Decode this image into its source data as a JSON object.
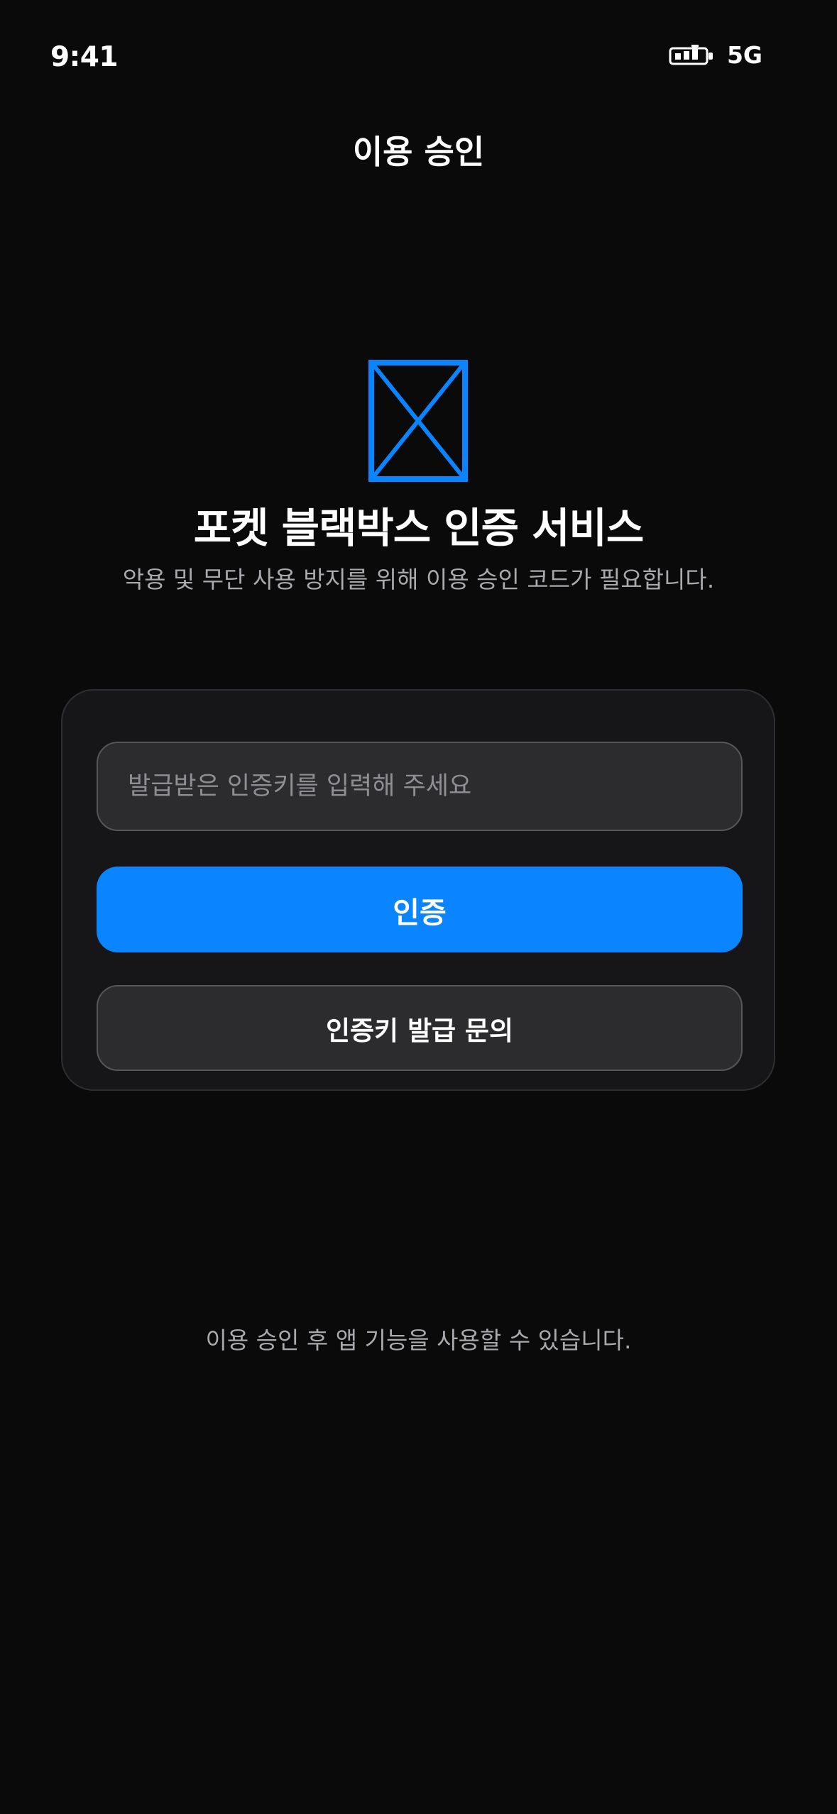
{
  "status_bar": {
    "time": "9:41",
    "network": "5G",
    "battery_icon": "battery-icon"
  },
  "nav": {
    "title": "이용 승인"
  },
  "hero": {
    "icon": "image-placeholder-icon",
    "icon_color": "#0a84ff",
    "title": "포켓 블랙박스 인증 서비스",
    "subtitle": "악용 및 무단 사용 방지를 위해 이용 승인 코드가 필요합니다."
  },
  "form": {
    "key_input": {
      "placeholder": "발급받은 인증키를 입력해 주세요",
      "value": ""
    },
    "verify_button": "인증",
    "inquiry_button": "인증키 발급 문의"
  },
  "footer": {
    "note": "이용 승인 후 앱 기능을 사용할 수 있습니다."
  },
  "colors": {
    "background": "#0a0a0a",
    "card": "#161618",
    "accent": "#0a84ff",
    "secondary_text": "#a9a9ae"
  }
}
